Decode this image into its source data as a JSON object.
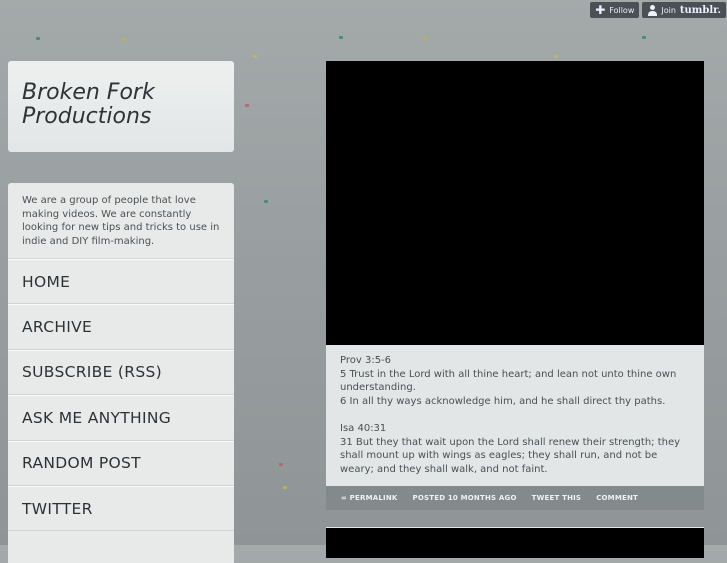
{
  "toolbar": {
    "follow_label": "Follow",
    "join_label": "Join",
    "join_brand": "tumblr."
  },
  "blog": {
    "title_line1": "Broken Fork",
    "title_line2": "Productions",
    "description": "We are a group of people that love making videos. We are constantly looking for new tips and tricks to use in indie and DIY film-making."
  },
  "nav": {
    "items": [
      {
        "label": "HOME"
      },
      {
        "label": "ARCHIVE"
      },
      {
        "label": "SUBSCRIBE (RSS)"
      },
      {
        "label": "ASK ME ANYTHING"
      },
      {
        "label": "RANDOM POST"
      },
      {
        "label": "TWITTER"
      }
    ]
  },
  "post": {
    "ref1": "Prov 3:5-6",
    "verse1": "5 Trust in the Lord with all thine heart; and lean not unto thine own understanding.",
    "verse2": "6 In all thy ways acknowledge him, and he shall direct thy paths.",
    "ref2": "Isa 40:31",
    "verse3": "31 But they that wait upon the Lord shall renew their strength; they shall mount up with wings as eagles; they shall run, and not be weary; and they shall walk, and not faint.",
    "footer": {
      "permalink": "∞ PERMALINK",
      "posted": "POSTED 10 MONTHS AGO",
      "tweet": "TWEET THIS",
      "comment": "COMMENT"
    }
  },
  "colors": {
    "background": "#9ea3a4",
    "panel": "#e8eaea",
    "footer_bar": "#838a8c"
  }
}
